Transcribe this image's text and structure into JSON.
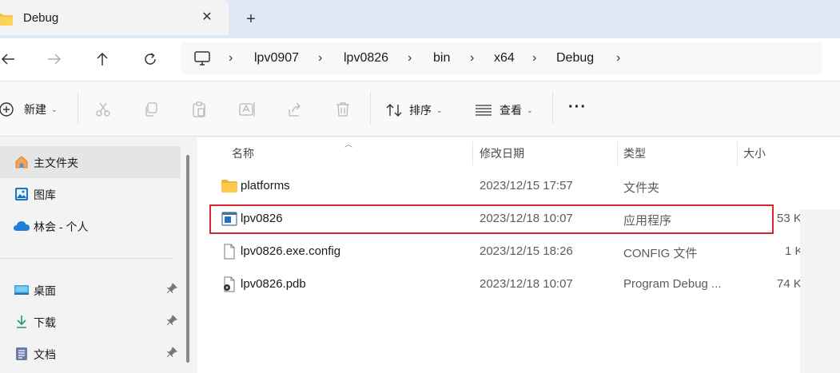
{
  "tab": {
    "title": "Debug",
    "close": "✕",
    "new_tab": "+"
  },
  "nav": {
    "back": "←",
    "forward": "→",
    "up": "↑",
    "refresh": "↻",
    "breadcrumbs": [
      "lpv0907",
      "lpv0826",
      "bin",
      "x64",
      "Debug"
    ],
    "separator": "›"
  },
  "toolbar": {
    "new_label": "新建",
    "sort_label": "排序",
    "view_label": "查看",
    "more": "···",
    "caret": "⌄"
  },
  "sidebar": {
    "items": [
      {
        "label": "主文件夹",
        "icon": "home-icon",
        "selected": true
      },
      {
        "label": "图库",
        "icon": "gallery-icon"
      },
      {
        "label": "林会 - 个人",
        "icon": "onedrive-cloud-icon"
      },
      {
        "label": "桌面",
        "icon": "desktop-icon",
        "pinned": true
      },
      {
        "label": "下载",
        "icon": "download-icon",
        "pinned": true
      },
      {
        "label": "文档",
        "icon": "documents-icon",
        "pinned": true
      }
    ]
  },
  "table": {
    "columns": [
      "名称",
      "修改日期",
      "类型",
      "大小"
    ],
    "rows": [
      {
        "name": "platforms",
        "date": "2023/12/15 17:57",
        "type": "文件夹",
        "size": "",
        "icon": "folder-icon"
      },
      {
        "name": "lpv0826",
        "date": "2023/12/18 10:07",
        "type": "应用程序",
        "size": "53 K",
        "icon": "application-icon"
      },
      {
        "name": "lpv0826.exe.config",
        "date": "2023/12/15 18:26",
        "type": "CONFIG 文件",
        "size": "1 K",
        "icon": "config-file-icon"
      },
      {
        "name": "lpv0826.pdb",
        "date": "2023/12/18 10:07",
        "type": "Program Debug ...",
        "size": "74 K",
        "icon": "pdb-file-icon"
      }
    ]
  },
  "colors": {
    "accent": "#0067c0",
    "highlight_border": "#d92433",
    "folder": "#f6c342"
  }
}
